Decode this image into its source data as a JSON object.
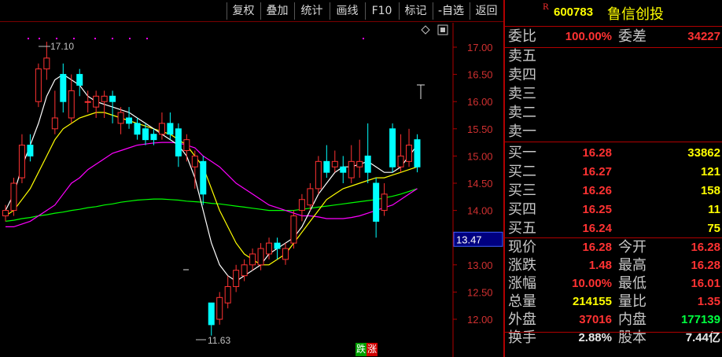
{
  "toolbar": {
    "buttons": [
      "复权",
      "叠加",
      "统计",
      "画线",
      "F10",
      "标记",
      "-自选",
      "返回"
    ]
  },
  "chart": {
    "price_ticks": [
      "17.00",
      "16.50",
      "16.00",
      "15.50",
      "15.00",
      "14.50",
      "14.00",
      "13.47",
      "13.00",
      "12.50",
      "12.00"
    ],
    "cursor_price": "13.47",
    "high_label": "17.10",
    "low_label": "11.63",
    "badge_die": "跌",
    "badge_zhang": "涨",
    "colors": {
      "up": "#ff3232",
      "down": "#00ffff",
      "ma5": "#ffffff",
      "ma10": "#ffff00",
      "ma20": "#ff00ff",
      "ma60": "#00ff00",
      "axis": "#b00000",
      "grid": "#7a0000"
    }
  },
  "chart_data": {
    "type": "candlestick",
    "ylim": [
      11.5,
      17.25
    ],
    "yticks": [
      17.0,
      16.5,
      16.0,
      15.5,
      15.0,
      14.5,
      14.0,
      13.0,
      12.5,
      12.0
    ],
    "candles": [
      [
        13.9,
        14.0,
        13.8,
        14.1
      ],
      [
        14.0,
        14.5,
        13.9,
        14.6
      ],
      [
        14.6,
        15.2,
        14.5,
        15.4
      ],
      [
        15.2,
        15.0,
        14.9,
        15.4
      ],
      [
        16.0,
        16.6,
        15.9,
        16.7
      ],
      [
        16.6,
        16.8,
        16.4,
        17.1
      ],
      [
        15.5,
        15.7,
        15.4,
        16.2
      ],
      [
        16.5,
        16.0,
        15.8,
        16.7
      ],
      [
        15.7,
        16.2,
        15.6,
        16.5
      ],
      [
        16.5,
        16.3,
        16.1,
        16.6
      ],
      [
        16.0,
        16.0,
        15.8,
        16.2
      ],
      [
        15.9,
        16.1,
        15.7,
        16.2
      ],
      [
        16.0,
        16.1,
        15.7,
        16.2
      ],
      [
        16.1,
        16.0,
        15.6,
        16.2
      ],
      [
        15.6,
        15.8,
        15.4,
        15.9
      ],
      [
        15.7,
        15.6,
        15.5,
        15.9
      ],
      [
        15.6,
        15.4,
        15.3,
        15.7
      ],
      [
        15.5,
        15.3,
        15.2,
        15.6
      ],
      [
        15.4,
        15.3,
        15.2,
        15.5
      ],
      [
        15.4,
        15.6,
        15.3,
        15.8
      ],
      [
        15.6,
        15.4,
        15.3,
        15.8
      ],
      [
        15.5,
        15.0,
        14.8,
        15.6
      ],
      [
        15.1,
        15.3,
        14.9,
        15.4
      ],
      [
        14.8,
        15.0,
        14.4,
        15.1
      ],
      [
        14.9,
        14.3,
        14.1,
        15.0
      ],
      [
        12.3,
        11.9,
        11.7,
        12.3
      ],
      [
        12.0,
        12.4,
        11.9,
        12.5
      ],
      [
        12.3,
        12.6,
        12.2,
        12.8
      ],
      [
        12.6,
        12.9,
        12.5,
        13.0
      ],
      [
        12.8,
        13.0,
        12.7,
        13.1
      ],
      [
        13.0,
        13.2,
        12.9,
        13.3
      ],
      [
        13.0,
        13.3,
        12.9,
        13.4
      ],
      [
        13.2,
        13.4,
        13.1,
        13.5
      ],
      [
        13.4,
        13.3,
        13.1,
        13.5
      ],
      [
        13.1,
        13.3,
        13.0,
        13.4
      ],
      [
        13.4,
        13.9,
        13.3,
        14.0
      ],
      [
        14.0,
        14.2,
        13.8,
        14.3
      ],
      [
        14.1,
        14.4,
        14.0,
        14.5
      ],
      [
        14.4,
        14.9,
        14.3,
        15.0
      ],
      [
        14.9,
        14.7,
        14.6,
        15.2
      ],
      [
        14.8,
        14.9,
        14.7,
        15.1
      ],
      [
        14.8,
        14.7,
        14.5,
        15.0
      ],
      [
        14.6,
        14.9,
        14.5,
        15.2
      ],
      [
        14.8,
        14.9,
        14.6,
        15.3
      ],
      [
        15.0,
        14.7,
        14.5,
        15.6
      ],
      [
        14.5,
        13.8,
        13.5,
        14.6
      ],
      [
        14.0,
        14.3,
        13.9,
        14.5
      ],
      [
        15.5,
        14.8,
        14.7,
        15.6
      ],
      [
        14.8,
        15.0,
        14.7,
        15.4
      ],
      [
        14.9,
        15.2,
        14.8,
        15.5
      ],
      [
        15.3,
        14.8,
        14.7,
        15.4
      ]
    ],
    "ma5": [
      14.0,
      14.3,
      14.8,
      15.2,
      15.6,
      16.1,
      16.4,
      16.5,
      16.4,
      16.3,
      16.1,
      16.0,
      15.95,
      15.9,
      15.85,
      15.8,
      15.7,
      15.6,
      15.5,
      15.4,
      15.3,
      15.2,
      15.0,
      14.6,
      14.0,
      13.4,
      13.0,
      12.8,
      12.7,
      12.8,
      12.9,
      13.0,
      13.2,
      13.3,
      13.4,
      13.5,
      13.7,
      14.0,
      14.3,
      14.5,
      14.7,
      14.8,
      14.8,
      14.85,
      14.9,
      14.8,
      14.7,
      14.7,
      14.8,
      15.0,
      15.2
    ],
    "ma10": [
      13.9,
      14.0,
      14.2,
      14.4,
      14.7,
      15.0,
      15.3,
      15.5,
      15.6,
      15.7,
      15.75,
      15.8,
      15.8,
      15.75,
      15.7,
      15.65,
      15.6,
      15.55,
      15.5,
      15.45,
      15.4,
      15.3,
      15.2,
      15.0,
      14.8,
      14.4,
      14.0,
      13.7,
      13.4,
      13.2,
      13.1,
      13.0,
      13.0,
      13.1,
      13.2,
      13.4,
      13.6,
      13.8,
      14.0,
      14.2,
      14.3,
      14.4,
      14.45,
      14.5,
      14.55,
      14.6,
      14.6,
      14.65,
      14.7,
      14.75,
      14.8
    ],
    "ma20": [
      13.7,
      13.7,
      13.75,
      13.8,
      13.9,
      14.0,
      14.1,
      14.3,
      14.5,
      14.6,
      14.75,
      14.85,
      14.95,
      15.05,
      15.1,
      15.15,
      15.2,
      15.22,
      15.24,
      15.25,
      15.25,
      15.24,
      15.2,
      15.15,
      15.0,
      14.9,
      14.8,
      14.65,
      14.5,
      14.4,
      14.3,
      14.2,
      14.1,
      14.05,
      14.0,
      13.95,
      13.9,
      13.9,
      13.88,
      13.85,
      13.85,
      13.85,
      13.87,
      13.9,
      13.95,
      14.0,
      14.05,
      14.1,
      14.2,
      14.3,
      14.4
    ],
    "ma60": [
      13.8,
      13.82,
      13.85,
      13.87,
      13.9,
      13.92,
      13.95,
      13.97,
      14.0,
      14.02,
      14.05,
      14.07,
      14.1,
      14.12,
      14.15,
      14.17,
      14.19,
      14.2,
      14.21,
      14.21,
      14.2,
      14.19,
      14.17,
      14.16,
      14.15,
      14.13,
      14.12,
      14.1,
      14.08,
      14.06,
      14.04,
      14.02,
      14.0,
      14.0,
      14.0,
      14.0,
      14.02,
      14.04,
      14.06,
      14.08,
      14.1,
      14.12,
      14.14,
      14.16,
      14.18,
      14.2,
      14.23,
      14.26,
      14.3,
      14.35,
      14.4
    ]
  },
  "quote": {
    "r_mark": "R",
    "code": "600783",
    "name": "鲁信创投",
    "weibi_label": "委比",
    "weibi_value": "100.00%",
    "weicha_label": "委差",
    "weicha_value": "34227",
    "sell": [
      {
        "label": "卖五",
        "price": "",
        "vol": ""
      },
      {
        "label": "卖四",
        "price": "",
        "vol": ""
      },
      {
        "label": "卖三",
        "price": "",
        "vol": ""
      },
      {
        "label": "卖二",
        "price": "",
        "vol": ""
      },
      {
        "label": "卖一",
        "price": "",
        "vol": ""
      }
    ],
    "buy": [
      {
        "label": "买一",
        "price": "16.28",
        "vol": "33862"
      },
      {
        "label": "买二",
        "price": "16.27",
        "vol": "121"
      },
      {
        "label": "买三",
        "price": "16.26",
        "vol": "158"
      },
      {
        "label": "买四",
        "price": "16.25",
        "vol": "11"
      },
      {
        "label": "买五",
        "price": "16.24",
        "vol": "75"
      }
    ],
    "stats": [
      {
        "l1": "现价",
        "v1": "16.28",
        "c1": "red",
        "l2": "今开",
        "v2": "16.28",
        "c2": "red"
      },
      {
        "l1": "涨跌",
        "v1": "1.48",
        "c1": "red",
        "l2": "最高",
        "v2": "16.28",
        "c2": "red"
      },
      {
        "l1": "涨幅",
        "v1": "10.00%",
        "c1": "red",
        "l2": "最低",
        "v2": "16.01",
        "c2": "red"
      },
      {
        "l1": "总量",
        "v1": "214155",
        "c1": "yellow",
        "l2": "量比",
        "v2": "1.35",
        "c2": "red"
      },
      {
        "l1": "外盘",
        "v1": "37016",
        "c1": "red",
        "l2": "内盘",
        "v2": "177139",
        "c2": "green"
      },
      {
        "l1": "换手",
        "v1": "2.88%",
        "c1": "white",
        "l2": "股本",
        "v2": "7.44亿",
        "c2": "white"
      }
    ]
  }
}
